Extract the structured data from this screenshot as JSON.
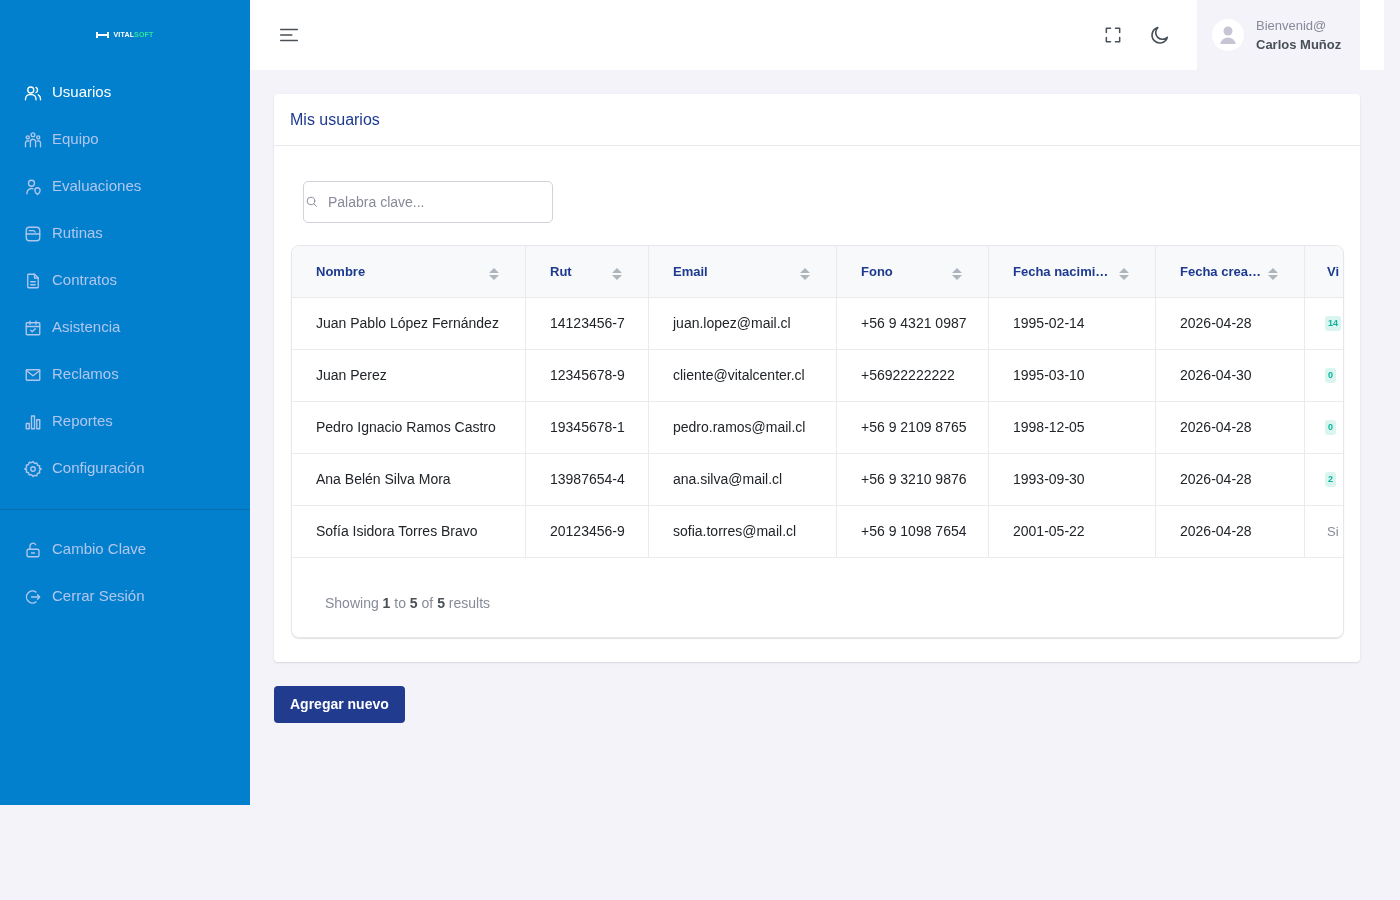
{
  "sidebar": {
    "logo": {
      "primary": "VITAL",
      "accent": "SOFT"
    },
    "items": [
      {
        "label": "Usuarios",
        "selected": true
      },
      {
        "label": "Equipo",
        "selected": false
      },
      {
        "label": "Evaluaciones",
        "selected": false
      },
      {
        "label": "Rutinas",
        "selected": false
      },
      {
        "label": "Contratos",
        "selected": false
      },
      {
        "label": "Asistencia",
        "selected": false
      },
      {
        "label": "Reclamos",
        "selected": false
      },
      {
        "label": "Reportes",
        "selected": false
      },
      {
        "label": "Configuración",
        "selected": false
      }
    ],
    "bottom_items": [
      {
        "label": "Cambio Clave",
        "selected": false
      },
      {
        "label": "Cerrar Sesión",
        "selected": false
      }
    ]
  },
  "header": {
    "greeting": "Bienvenid@",
    "user_name": "Carlos Muñoz"
  },
  "card": {
    "title": "Mis usuarios",
    "search": {
      "placeholder": "Palabra clave..."
    },
    "table": {
      "columns": [
        {
          "label": "Nombre",
          "sortable": true
        },
        {
          "label": "Rut",
          "sortable": true
        },
        {
          "label": "Email",
          "sortable": true
        },
        {
          "label": "Fono",
          "sortable": true
        },
        {
          "label": "Fecha nacimi…",
          "sortable": true
        },
        {
          "label": "Fecha crea…",
          "sortable": true
        },
        {
          "label": "Vi",
          "sortable": false
        }
      ],
      "rows": [
        {
          "cells": [
            "Juan Pablo López Fernández",
            "14123456-7",
            "juan.lopez@mail.cl",
            "+56 9 4321 0987",
            "1995-02-14",
            "2026-04-28"
          ],
          "column_7": {
            "kind": "badge",
            "text": "14"
          }
        },
        {
          "cells": [
            "Juan Perez",
            "12345678-9",
            "cliente@vitalcenter.cl",
            "+56922222222",
            "1995-03-10",
            "2026-04-30"
          ],
          "column_7": {
            "kind": "badge",
            "text": "0"
          }
        },
        {
          "cells": [
            "Pedro Ignacio Ramos Castro",
            "19345678-1",
            "pedro.ramos@mail.cl",
            "+56 9 2109 8765",
            "1998-12-05",
            "2026-04-28"
          ],
          "column_7": {
            "kind": "badge",
            "text": "0"
          }
        },
        {
          "cells": [
            "Ana Belén Silva Mora",
            "13987654-4",
            "ana.silva@mail.cl",
            "+56 9 3210 9876",
            "1993-09-30",
            "2026-04-28"
          ],
          "column_7": {
            "kind": "badge",
            "text": "2"
          }
        },
        {
          "cells": [
            "Sofía Isidora Torres Bravo",
            "20123456-9",
            "sofia.torres@mail.cl",
            "+56 9 1098 7654",
            "2001-05-22",
            "2026-04-28"
          ],
          "column_7": {
            "kind": "text",
            "text": "Si"
          }
        }
      ]
    },
    "summary": "Showing **1** to **5** of **5** results"
  },
  "add_button": "Agregar nuevo"
}
